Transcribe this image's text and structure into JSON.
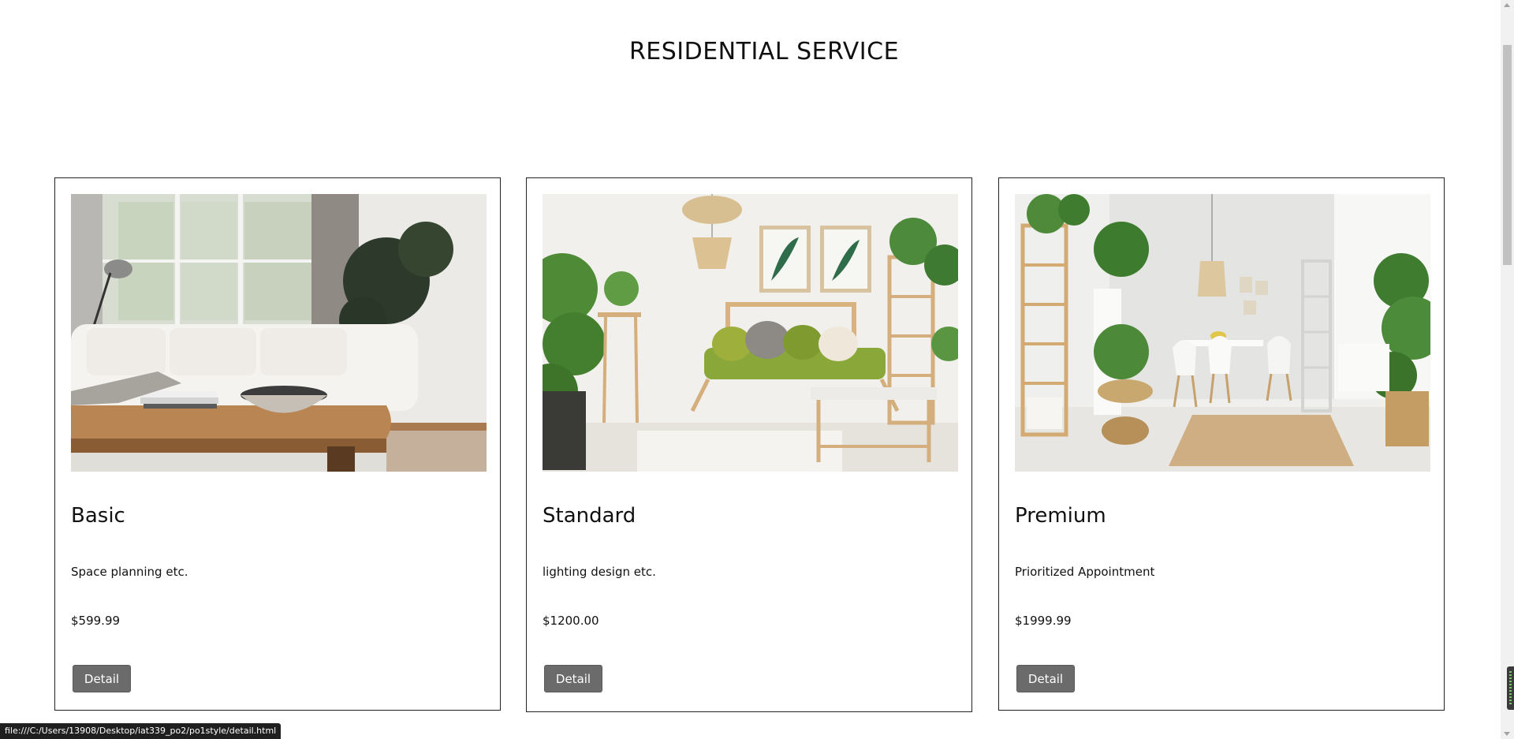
{
  "page": {
    "title": "RESIDENTIAL SERVICE"
  },
  "cards": [
    {
      "name": "Basic",
      "description": "Space planning etc.",
      "price": "$599.99",
      "button_label": "Detail"
    },
    {
      "name": "Standard",
      "description": "lighting design etc.",
      "price": "$1200.00",
      "button_label": "Detail"
    },
    {
      "name": "Premium",
      "description": "Prioritized Appointment",
      "price": "$1999.99",
      "button_label": "Detail"
    }
  ],
  "status_bar": {
    "url": "file:///C:/Users/13908/Desktop/iat339_po2/po1style/detail.html"
  },
  "colors": {
    "button_bg": "#6b6b6b",
    "card_border": "#222222",
    "text": "#111111"
  }
}
